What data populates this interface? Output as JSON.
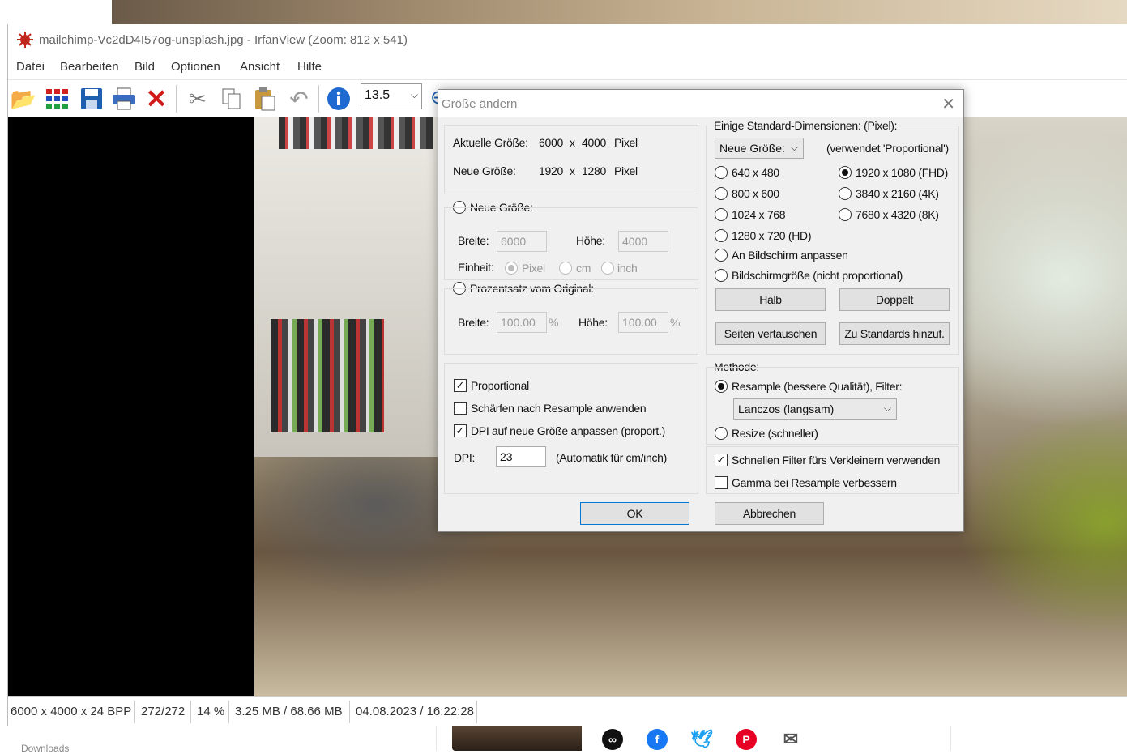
{
  "window": {
    "title": "mailchimp-Vc2dD4I57og-unsplash.jpg - IrfanView (Zoom: 812 x 541)"
  },
  "menu": [
    "Datei",
    "Bearbeiten",
    "Bild",
    "Optionen",
    "Ansicht",
    "Hilfe"
  ],
  "toolbar": {
    "zoom_value": "13.5",
    "icons": [
      "open-folder-icon",
      "thumbnails-icon",
      "save-icon",
      "print-icon",
      "delete-icon",
      "cut-icon",
      "copy-icon",
      "paste-icon",
      "undo-icon",
      "info-icon"
    ]
  },
  "statusbar": {
    "dimensions": "6000 x 4000 x 24 BPP",
    "index": "272/272",
    "zoom": "14 %",
    "memory": "3.25 MB / 68.66 MB",
    "datetime": "04.08.2023 / 16:22:28"
  },
  "background_page": {
    "side_text": "Downloads",
    "share_icons": [
      "link-icon",
      "facebook-icon",
      "twitter-icon",
      "pinterest-icon",
      "mail-icon"
    ],
    "colors": {
      "facebook": "#1877f2",
      "twitter": "#1da1f2",
      "pinterest": "#e60023",
      "link": "#111111",
      "mail": "#555555"
    }
  },
  "dialog": {
    "title": "Größe ändern",
    "current_size_label": "Aktuelle Größe:",
    "current_w": "6000",
    "current_x": "x",
    "current_h": "4000",
    "current_unit": "Pixel",
    "new_size_label": "Neue Größe:",
    "new_w": "1920",
    "new_x": "x",
    "new_h": "1280",
    "new_unit": "Pixel",
    "opt_new_size": "Neue Größe:",
    "width_label": "Breite:",
    "width_value": "6000",
    "height_label": "Höhe:",
    "height_value": "4000",
    "unit_label": "Einheit:",
    "unit_pixel": "Pixel",
    "unit_cm": "cm",
    "unit_inch": "inch",
    "opt_percent": "Prozentsatz vom Original:",
    "pct_width_label": "Breite:",
    "pct_width_value": "100.00",
    "pct_sign": "%",
    "pct_height_label": "Höhe:",
    "pct_height_value": "100.00",
    "pct_sign2": "%",
    "chk_proportional": "Proportional",
    "chk_sharpen": "Schärfen nach Resample anwenden",
    "chk_dpi": "DPI auf neue Größe anpassen (proport.)",
    "dpi_label": "DPI:",
    "dpi_value": "23",
    "dpi_note": "(Automatik für cm/inch)",
    "std_title": "Einige Standard-Dimensionen: (Pixel):",
    "std_combo": "Neue Größe:",
    "std_note": "(verwendet 'Proportional')",
    "std_options": [
      "640 x 480",
      "800 x 600",
      "1024 x 768",
      "1280 x 720  (HD)",
      "1920 x 1080 (FHD)",
      "3840 x 2160 (4K)",
      "7680 x 4320 (8K)"
    ],
    "opt_fit_screen": "An Bildschirm anpassen",
    "opt_screen_size": "Bildschirmgröße (nicht proportional)",
    "btn_half": "Halb",
    "btn_double": "Doppelt",
    "btn_swap": "Seiten vertauschen",
    "btn_add_std": "Zu Standards hinzuf.",
    "method_label": "Methode:",
    "opt_resample": "Resample (bessere Qualität), Filter:",
    "filter_value": "Lanczos (langsam)",
    "opt_resize": "Resize (schneller)",
    "chk_fast_filter": "Schnellen Filter fürs Verkleinern verwenden",
    "chk_gamma": "Gamma bei Resample verbessern",
    "btn_ok": "OK",
    "btn_cancel": "Abbrechen"
  }
}
